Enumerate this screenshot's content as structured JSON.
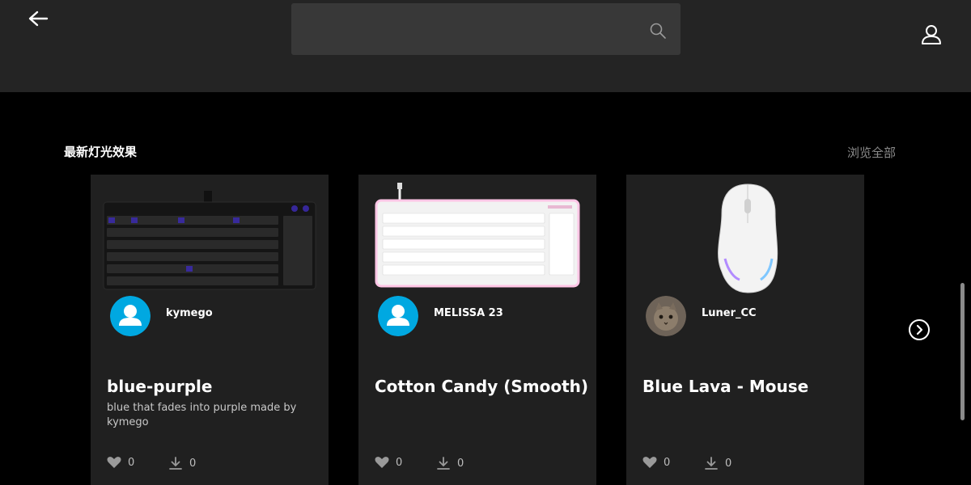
{
  "header": {
    "search_placeholder": ""
  },
  "section": {
    "title": "最新灯光效果",
    "browse_all": "浏览全部"
  },
  "cards": [
    {
      "author": "kymego",
      "name": "blue-purple",
      "description": "blue that fades into purple made by kymego",
      "likes": "0",
      "downloads": "0",
      "avatar": "default-user-avatar",
      "device": "keyboard-dark"
    },
    {
      "author": "MELISSA 23",
      "name": "Cotton Candy (Smooth)",
      "description": "",
      "likes": "0",
      "downloads": "0",
      "avatar": "default-user-avatar",
      "device": "keyboard-white"
    },
    {
      "author": "Luner_CC",
      "name": "Blue Lava - Mouse",
      "description": "",
      "likes": "0",
      "downloads": "0",
      "avatar": "cat-photo-avatar",
      "device": "mouse-white"
    }
  ],
  "colors": {
    "background": "#000000",
    "topbar": "#242424",
    "card": "#202020",
    "avatar_blue": "#00a8e1",
    "muted_text": "#8a8a8a"
  }
}
